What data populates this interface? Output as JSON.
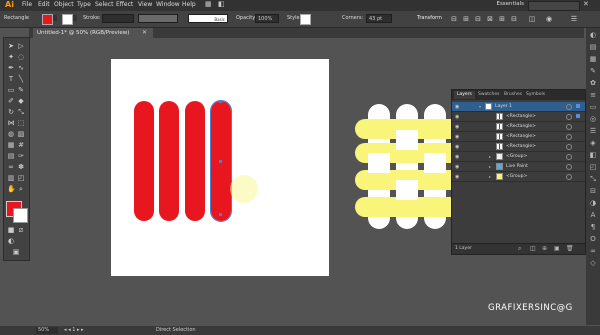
{
  "app": {
    "logo": "Ai"
  },
  "menu": [
    "File",
    "Edit",
    "Object",
    "Type",
    "Select",
    "Effect",
    "View",
    "Window",
    "Help"
  ],
  "workspace": {
    "label": "Essentials"
  },
  "control": {
    "selection_label": "Rectangle",
    "stroke_label": "Stroke:",
    "brush_label": "Basic",
    "opacity_label": "Opacity:",
    "opacity_value": "100%",
    "style_label": "Style:",
    "corners_label": "Corners:",
    "corners_value": "43 pt",
    "transform_label": "Transform",
    "fill_color": "#e8161f"
  },
  "document": {
    "tab_title": "Untitled-1* @ 50% (RGB/Preview)"
  },
  "swatches": {
    "fill": "#e8161f",
    "stroke": "#ffffff"
  },
  "layers_panel": {
    "tabs": [
      "Layers",
      "Swatches",
      "Brushes",
      "Symbols"
    ],
    "rows": [
      {
        "name": "Layer 1",
        "indent": 0,
        "thumb": "layer"
      },
      {
        "name": "<Rectangle>",
        "indent": 1,
        "thumb": "red"
      },
      {
        "name": "<Rectangle>",
        "indent": 1,
        "thumb": "red"
      },
      {
        "name": "<Rectangle>",
        "indent": 1,
        "thumb": "red"
      },
      {
        "name": "<Rectangle>",
        "indent": 1,
        "thumb": "red"
      },
      {
        "name": "<Group>",
        "indent": 1,
        "thumb": "group"
      },
      {
        "name": "Live Paint",
        "indent": 1,
        "thumb": "paint"
      },
      {
        "name": "<Group>",
        "indent": 1,
        "thumb": "yellow"
      }
    ],
    "footer_label": "1 Layer"
  },
  "status": {
    "zoom": "50%",
    "tool": "Direct Selection"
  },
  "watermark": "GRAFIXERSINC@G"
}
